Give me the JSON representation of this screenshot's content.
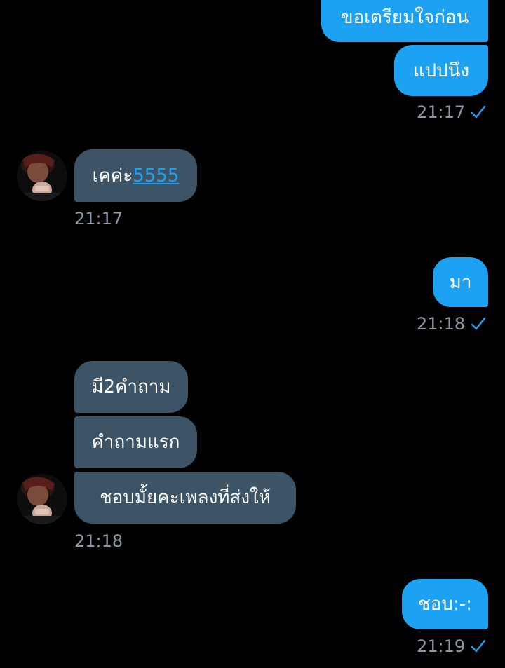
{
  "messages": {
    "m1": "ขอเตรียมใจก่อน",
    "m2": "แปปนึง",
    "m2_time": "21:17",
    "m3_prefix": "เคค่ะ",
    "m3_link": "5555",
    "m3_time": "21:17",
    "m4": "มา",
    "m4_time": "21:18",
    "m5": "มี2คำถาม",
    "m6": "คำถามแรก",
    "m7": "ชอบมั้ยคะเพลงที่ส่งให้",
    "m7_time": "21:18",
    "m8": "ชอบ:-:",
    "m8_time": "21:19"
  },
  "colors": {
    "background": "#000000",
    "sent_bubble": "#1da1f2",
    "received_bubble": "#3d5466",
    "timestamp": "#8b98a5",
    "read_check": "#1da1f2"
  },
  "icons": {
    "read_receipt": "checkmark-icon",
    "avatar": "user-avatar"
  }
}
